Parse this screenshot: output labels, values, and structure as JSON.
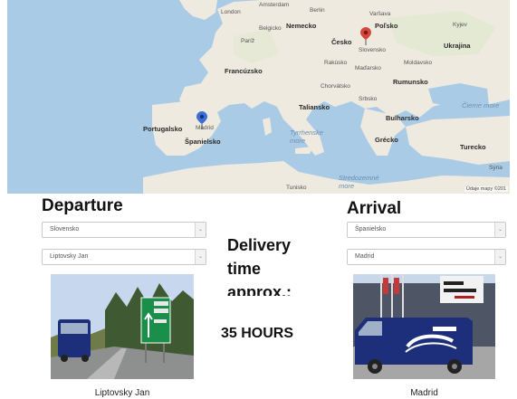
{
  "map": {
    "labels": {
      "london": "London",
      "amsterdam": "Amsterdam",
      "belgicko": "Belgicko",
      "nemecko": "Nemecko",
      "berlin": "Berlin",
      "varsava": "Varšava",
      "polsko": "Poľsko",
      "kyjev": "Kyjev",
      "pariz": "Paríž",
      "cesko": "Česko",
      "slovensko": "Slovensko",
      "ukrajina": "Ukrajina",
      "francuzsko": "Francúzsko",
      "rakusko": "Rakúsko",
      "madarsko": "Maďarsko",
      "moldavsko": "Moldavsko",
      "chorvatsko": "Chorvátsko",
      "rumunsko": "Rumunsko",
      "talliansko": "Taliansko",
      "srbsko": "Srbsko",
      "cierne_more": "Čierne more",
      "portugalsko": "Portugalsko",
      "madrid": "Madrid",
      "spanielsko": "Španielsko",
      "bulharsko": "Bulharsko",
      "tyrrhenske": "Tyrrhenske more",
      "grecko": "Grécko",
      "turecko": "Turecko",
      "tunisko": "Tunisko",
      "stredozemne": "Stredozemné more",
      "syria": "Sýria"
    },
    "copyright": "Údaje mapy ©201"
  },
  "departure": {
    "heading": "Departure",
    "country_value": "Slovensko",
    "city_value": "Liptovsky Jan",
    "photo_caption": "Liptovsky Jan"
  },
  "arrival": {
    "heading": "Arrival",
    "country_value": "Španielsko",
    "city_value": "Madrid",
    "photo_caption": "Madrid"
  },
  "delivery": {
    "label": "Delivery time approx.:",
    "value": "35 HOURS"
  },
  "colors": {
    "sea": "#a9cbe6",
    "land": "#eeeadf",
    "pin_departure": "#d6473b",
    "pin_arrival": "#3b6fd6",
    "van": "#1d2f7a",
    "road_sign": "#1a8f4a"
  }
}
